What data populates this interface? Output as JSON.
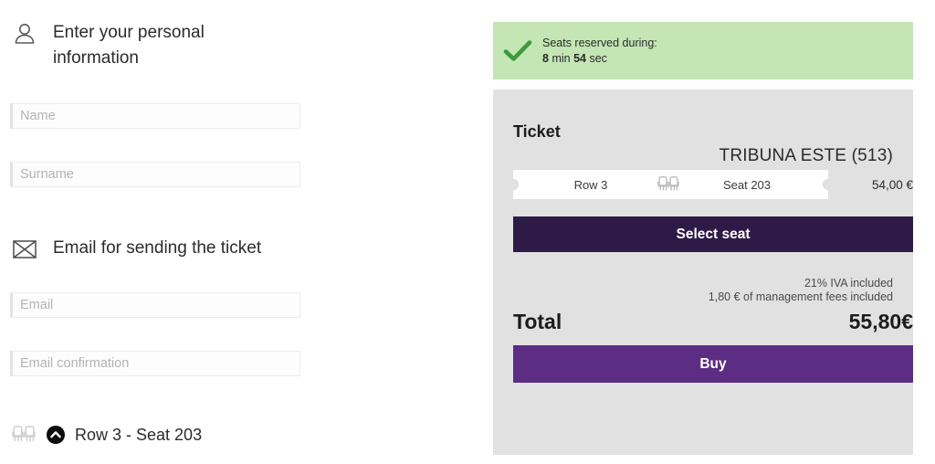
{
  "left": {
    "personal_info": {
      "icon": "person-icon",
      "heading": "Enter your personal information"
    },
    "fields": [
      {
        "name": "name",
        "placeholder": "Name",
        "value": ""
      },
      {
        "name": "surname",
        "placeholder": "Surname",
        "value": ""
      },
      {
        "name": "email",
        "placeholder": "Email",
        "value": ""
      },
      {
        "name": "email_confirmation",
        "placeholder": "Email confirmation",
        "value": ""
      }
    ],
    "email_section": {
      "icon": "envelope-icon",
      "heading": "Email for sending the ticket"
    },
    "seat_summary": {
      "seat_icon": "seat-pair-icon",
      "toggle_icon": "chevron-up-circle-icon",
      "label": "Row 3 - Seat 203"
    }
  },
  "right": {
    "banner": {
      "icon": "check-icon",
      "line1": "Seats reserved during:",
      "minutes": "8",
      "minutes_unit": "min",
      "seconds": "54",
      "seconds_unit": "sec",
      "background_color": "#c4e5b4"
    },
    "ticket": {
      "title": "Ticket",
      "zone": "TRIBUNA ESTE (513)",
      "row": "Row 3",
      "seat_icon": "seat-pair-icon",
      "seat": "Seat 203",
      "price": "54,00 €",
      "select_seat_label": "Select seat",
      "select_seat_color": "#2e1a47"
    },
    "summary": {
      "tax_note": "21% IVA included",
      "fees_note": "1,80 € of management fees included",
      "total_label": "Total",
      "total_value": "55,80€",
      "buy_label": "Buy",
      "buy_color": "#5c2d82"
    },
    "panel_color": "#e1e1e1"
  }
}
